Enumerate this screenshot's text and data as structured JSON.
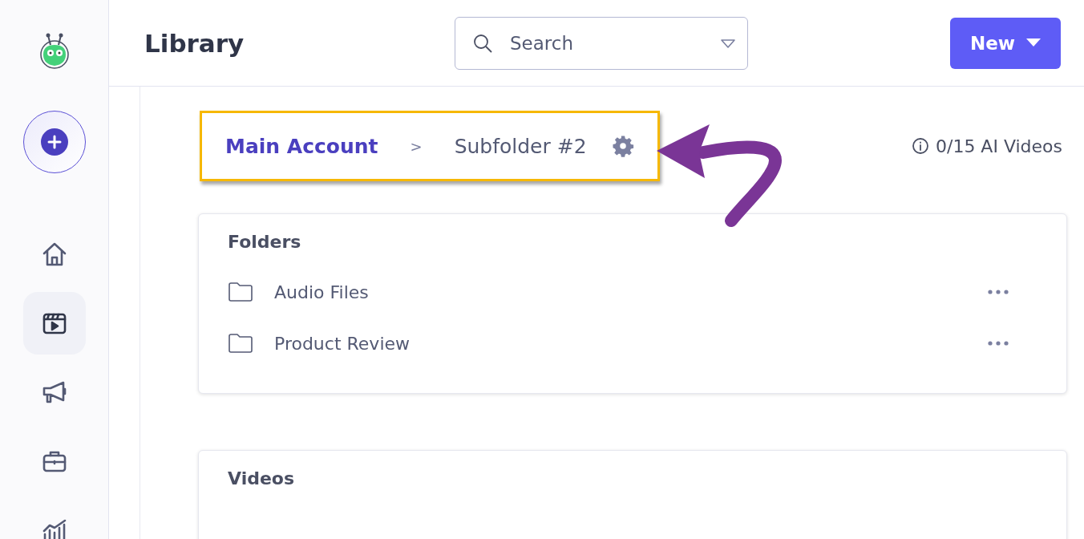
{
  "sidebar": {
    "nav_items": [
      {
        "selected": false
      },
      {
        "selected": true
      },
      {
        "selected": false
      },
      {
        "selected": false
      },
      {
        "selected": false
      }
    ]
  },
  "header": {
    "title": "Library",
    "search": {
      "placeholder": "Search"
    },
    "new_button": "New"
  },
  "breadcrumb": {
    "items": [
      {
        "label": "Main Account",
        "selected": false
      },
      {
        "label": "Subfolder #2",
        "selected": true
      }
    ],
    "separator": ">"
  },
  "usage": "0/15 AI Videos",
  "folders": {
    "title": "Folders",
    "items": [
      {
        "name": "Audio Files"
      },
      {
        "name": "Product Review"
      }
    ]
  },
  "videos": {
    "title": "Videos"
  }
}
